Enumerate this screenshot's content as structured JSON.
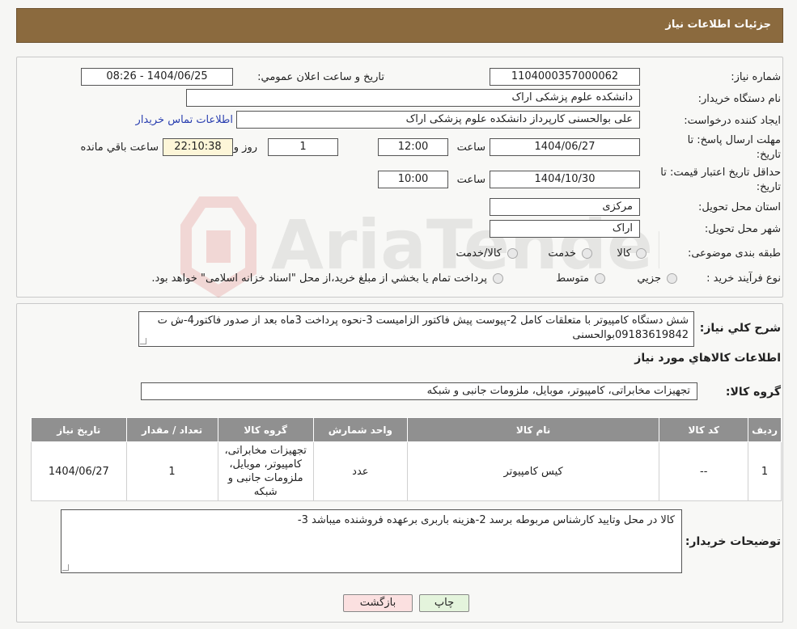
{
  "header": {
    "title": "جزئیات اطلاعات نیاز"
  },
  "form": {
    "need_number_label": "شماره نیاز:",
    "need_number": "1104000357000062",
    "announce_label": "تاریخ و ساعت اعلان عمومي:",
    "announce_value": "1404/06/25 - 08:26",
    "buyer_org_label": "نام دستگاه خريدار:",
    "buyer_org": "دانشکده علوم پزشکی اراک",
    "creator_label": "ايجاد کننده درخواست:",
    "creator": "علی بوالحسنی کارپرداز دانشکده علوم پزشکی اراک",
    "contact_link": "اطلاعات تماس خريدار",
    "deadline_label_line1": "مهلت ارسال پاسخ: تا",
    "deadline_label_line2": "تاريخ:",
    "deadline_date": "1404/06/27",
    "time_label": "ساعت",
    "deadline_time": "12:00",
    "days_value": "1",
    "days_label": "روز و",
    "remaining_time": "22:10:38",
    "remaining_label": "ساعت باقي مانده",
    "validity_label_line1": "حداقل تاريخ اعتبار قيمت: تا",
    "validity_label_line2": "تاريخ:",
    "validity_date": "1404/10/30",
    "validity_time_label": "ساعت",
    "validity_time": "10:00",
    "province_label": "استان محل تحويل:",
    "province": "مرکزی",
    "city_label": "شهر محل تحويل:",
    "city": "اراک",
    "category_label": "طبقه بندی موضوعی:",
    "category_options": [
      "کالا",
      "خدمت",
      "کالا/خدمت"
    ],
    "process_label": "نوع فرآيند خريد :",
    "process_options": [
      "جزيي",
      "متوسط"
    ],
    "process_note": "پرداخت تمام يا بخشي از مبلغ خريد،از محل \"اسناد خزانه اسلامی\" خواهد بود."
  },
  "summary": {
    "label": "شرح کلي نياز:",
    "text": "شش دستگاه کامپیوتر با متعلقات کامل 2-پیوست پیش فاکتور الزامیست 3-نحوه پرداخت 3ماه بعد از صدور فاکتور4-ش ت 09183619842بوالحسنی",
    "items_title": "اطلاعات کالاهاي مورد نياز",
    "group_label": "گروه کالا:",
    "group_value": "تجهیزات مخابراتی، کامپیوتر، موبایل، ملزومات جانبی و شبکه"
  },
  "table": {
    "headers": [
      "رديف",
      "کد کالا",
      "نام کالا",
      "واحد شمارش",
      "گروه کالا",
      "تعداد / مقدار",
      "تاريخ نياز"
    ],
    "row": {
      "index": "1",
      "code": "--",
      "name": "کیس کامپیوتر",
      "unit": "عدد",
      "group": "تجهیزات مخابراتی، کامپیوتر، موبایل، ملزومات جانبی و شبکه",
      "qty": "1",
      "date": "1404/06/27"
    }
  },
  "buyer_notes": {
    "label": "توضيحات خريدار:",
    "text": "کالا در محل  وتایید کارشناس مربوطه برسد 2-هزینه باربری برعهده فروشنده میباشد 3-"
  },
  "buttons": {
    "print": "چاپ",
    "back": "بازگشت"
  },
  "watermark": {
    "text": "AriaTender.neT"
  },
  "colors": {
    "header_bg": "#8b6a3e",
    "table_header_bg": "#909090",
    "back_button_bg": "#fbe0e0",
    "print_button_bg": "#e4f4dc"
  }
}
